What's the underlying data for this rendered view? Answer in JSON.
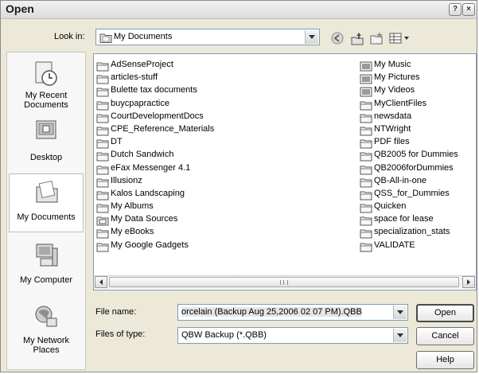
{
  "window": {
    "title": "Open",
    "help_glyph": "?",
    "close_glyph": "×"
  },
  "look_in": {
    "label": "Look in:",
    "value": "My Documents"
  },
  "toolbar_icons": [
    "back-icon",
    "up-folder-icon",
    "new-folder-icon",
    "view-menu-icon"
  ],
  "places": [
    {
      "name": "recent-documents",
      "label": "My Recent Documents",
      "icon": "recent-documents-icon",
      "selected": false
    },
    {
      "name": "desktop",
      "label": "Desktop",
      "icon": "desktop-icon",
      "selected": false
    },
    {
      "name": "my-documents",
      "label": "My Documents",
      "icon": "my-documents-icon",
      "selected": true
    },
    {
      "name": "my-computer",
      "label": "My Computer",
      "icon": "my-computer-icon",
      "selected": false
    },
    {
      "name": "my-network-places",
      "label": "My Network Places",
      "icon": "network-places-icon",
      "selected": false
    }
  ],
  "files_left": [
    {
      "name": "AdSenseProject",
      "icon": "folder-icon"
    },
    {
      "name": "articles-stuff",
      "icon": "folder-icon"
    },
    {
      "name": "Bulette tax documents",
      "icon": "folder-icon"
    },
    {
      "name": "buycpapractice",
      "icon": "folder-icon"
    },
    {
      "name": "CourtDevelopmentDocs",
      "icon": "folder-icon"
    },
    {
      "name": "CPE_Reference_Materials",
      "icon": "folder-icon"
    },
    {
      "name": "DT",
      "icon": "folder-icon"
    },
    {
      "name": "Dutch Sandwich",
      "icon": "folder-icon"
    },
    {
      "name": "eFax Messenger 4.1",
      "icon": "folder-icon"
    },
    {
      "name": "Illusionz",
      "icon": "folder-icon"
    },
    {
      "name": "Kalos Landscaping",
      "icon": "folder-icon"
    },
    {
      "name": "My Albums",
      "icon": "folder-icon"
    },
    {
      "name": "My Data Sources",
      "icon": "data-sources-folder-icon"
    },
    {
      "name": "My eBooks",
      "icon": "folder-icon"
    },
    {
      "name": "My Google Gadgets",
      "icon": "folder-icon"
    }
  ],
  "files_right": [
    {
      "name": "My Music",
      "icon": "music-folder-icon"
    },
    {
      "name": "My Pictures",
      "icon": "pictures-folder-icon"
    },
    {
      "name": "My Videos",
      "icon": "videos-folder-icon"
    },
    {
      "name": "MyClientFiles",
      "icon": "folder-icon"
    },
    {
      "name": "newsdata",
      "icon": "folder-icon"
    },
    {
      "name": "NTWright",
      "icon": "folder-icon"
    },
    {
      "name": "PDF files",
      "icon": "folder-icon"
    },
    {
      "name": "QB2005 for Dummies",
      "icon": "folder-icon"
    },
    {
      "name": "QB2006forDummies",
      "icon": "folder-icon"
    },
    {
      "name": "QB-All-in-one",
      "icon": "folder-icon"
    },
    {
      "name": "QSS_for_Dummies",
      "icon": "folder-icon"
    },
    {
      "name": "Quicken",
      "icon": "folder-icon"
    },
    {
      "name": "space for lease",
      "icon": "folder-icon"
    },
    {
      "name": "specialization_stats",
      "icon": "folder-icon"
    },
    {
      "name": "VALIDATE",
      "icon": "folder-icon"
    }
  ],
  "file_name": {
    "label": "File name:",
    "value": "orcelain (Backup Aug 25,2006  02 07 PM).QBB"
  },
  "file_type": {
    "label": "Files of type:",
    "value": "QBW Backup (*.QBB)"
  },
  "buttons": {
    "open": "Open",
    "cancel": "Cancel",
    "help": "Help"
  },
  "colors": {
    "dialog_bg": "#ece9d8",
    "field_border": "#7f9db9",
    "selection_bg": "#ffffff"
  }
}
